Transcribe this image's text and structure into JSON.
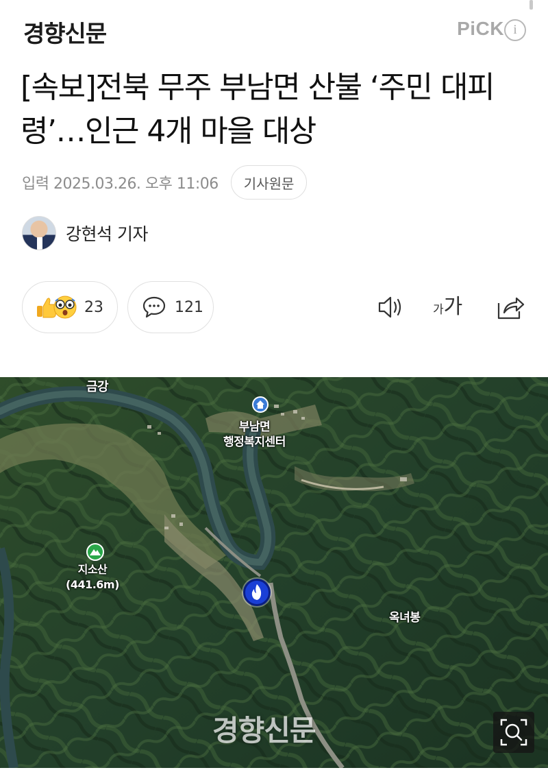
{
  "header": {
    "brand": "경향신문",
    "pick_label": "PiCK",
    "info_symbol": "i"
  },
  "article": {
    "title": "[속보]전북 무주 부남면 산불 ‘주민 대피령’…인근 4개 마을 대상",
    "date": "입력 2025.03.26. 오후 11:06",
    "origin_button": "기사원문",
    "author": "강현석 기자"
  },
  "actions": {
    "reaction_count": "23",
    "comment_count": "121",
    "font_size_small": "가",
    "font_size_large": "가"
  },
  "photo": {
    "labels": {
      "river": "금강",
      "office_line1": "부남면",
      "office_line2": "행정복지센터",
      "peak_name": "지소산",
      "peak_height": "(441.6m)",
      "okn": "옥녀봉"
    },
    "watermark": "경향신문"
  },
  "colors": {
    "fire_pin": "#1a3fd6",
    "muted_text": "#8c8c8c",
    "pick_gray": "#a9a9a9"
  },
  "icons": [
    "info-icon",
    "thumbs-up-icon",
    "surprised-face-icon",
    "comment-bubble-icon",
    "speaker-icon",
    "font-size-icon",
    "share-icon",
    "fire-icon",
    "home-icon",
    "mountain-icon",
    "zoom-search-icon"
  ]
}
